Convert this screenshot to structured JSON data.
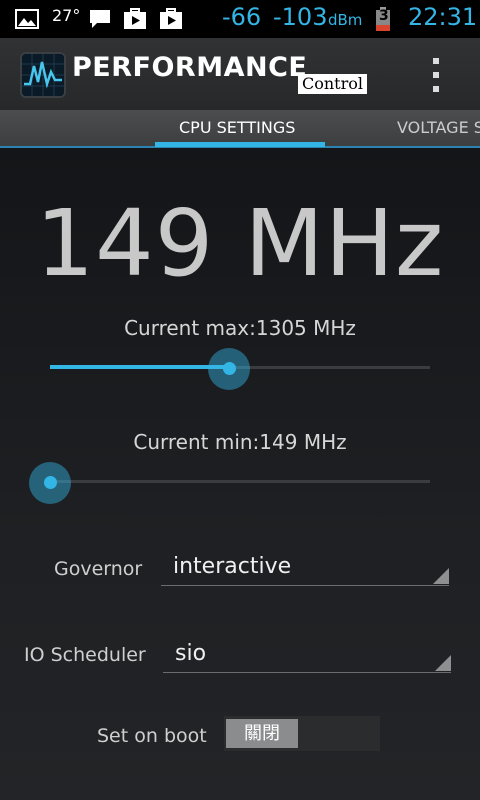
{
  "status_bar": {
    "temperature": "27°",
    "signal_dbm_1": "-66",
    "signal_dbm_2": "-103",
    "signal_unit": "dBm",
    "battery_level": "3",
    "time": "22:31",
    "icons": [
      "image-icon",
      "chat-icon",
      "play-store-icon",
      "play-store-icon",
      "battery-icon"
    ]
  },
  "action_bar": {
    "title": "PERFORMANCE",
    "subtitle": "Control",
    "overflow_icon": "overflow-menu-icon"
  },
  "tabs": [
    {
      "label": "CPU SETTINGS",
      "active": true
    },
    {
      "label": "VOLTAGE S",
      "active": false
    }
  ],
  "cpu": {
    "current_frequency": "149 MHz",
    "max_label": "Current max:1305 MHz",
    "max_slider_position": 0.47,
    "min_label": "Current min:149 MHz",
    "min_slider_position": 0.0,
    "governor_label": "Governor",
    "governor_value": "interactive",
    "scheduler_label": "IO Scheduler",
    "scheduler_value": "sio",
    "boot_label": "Set on boot",
    "boot_toggle_text": "關閉"
  },
  "colors": {
    "accent": "#33b5e5"
  }
}
